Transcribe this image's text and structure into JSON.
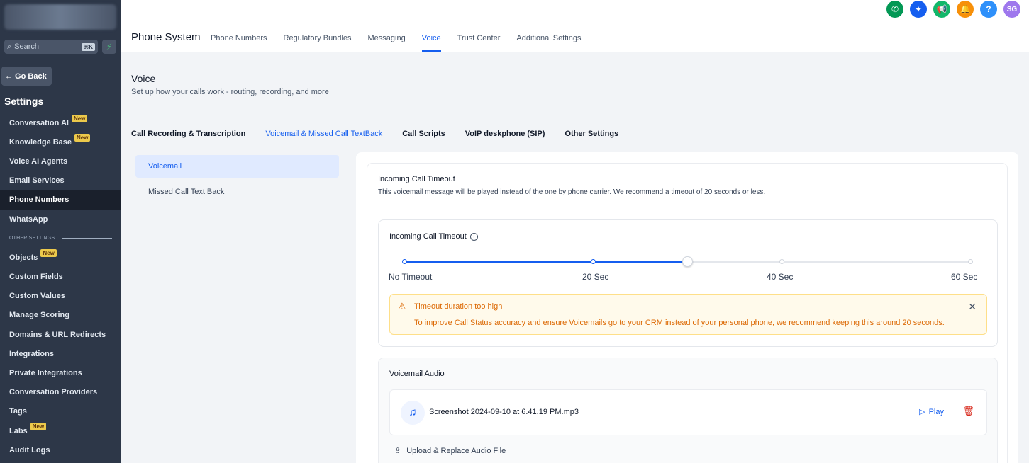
{
  "sidebar": {
    "search_placeholder": "Search",
    "search_shortcut": "⌘K",
    "go_back": "← Go Back",
    "title": "Settings",
    "items": [
      {
        "label": "Conversation AI",
        "badge": "New"
      },
      {
        "label": "Knowledge Base",
        "badge": "New"
      },
      {
        "label": "Voice AI Agents"
      },
      {
        "label": "Email Services"
      },
      {
        "label": "Phone Numbers",
        "active": true
      },
      {
        "label": "WhatsApp"
      },
      {
        "section": "OTHER SETTINGS"
      },
      {
        "label": "Objects",
        "badge": "New"
      },
      {
        "label": "Custom Fields"
      },
      {
        "label": "Custom Values"
      },
      {
        "label": "Manage Scoring"
      },
      {
        "label": "Domains & URL Redirects"
      },
      {
        "label": "Integrations"
      },
      {
        "label": "Private Integrations"
      },
      {
        "label": "Conversation Providers"
      },
      {
        "label": "Tags"
      },
      {
        "label": "Labs",
        "badge": "New"
      },
      {
        "label": "Audit Logs"
      }
    ]
  },
  "topbar": {
    "avatar_initials": "SG",
    "icons": [
      {
        "name": "phone-icon",
        "color": "#039855",
        "glyph": "✆"
      },
      {
        "name": "rocket-icon",
        "color": "#155eef",
        "glyph": "✦"
      },
      {
        "name": "megaphone-icon",
        "color": "#12b76a",
        "glyph": "📢"
      },
      {
        "name": "bell-icon",
        "color": "#f79009",
        "glyph": "🔔"
      },
      {
        "name": "help-icon",
        "color": "#2e90fa",
        "glyph": "?"
      }
    ]
  },
  "header": {
    "title": "Phone System",
    "tabs": [
      "Phone Numbers",
      "Regulatory Bundles",
      "Messaging",
      "Voice",
      "Trust Center",
      "Additional Settings"
    ],
    "active_tab": "Voice"
  },
  "page": {
    "title": "Voice",
    "subtitle": "Set up how your calls work - routing, recording, and more",
    "subtabs": [
      "Call Recording & Transcription",
      "Voicemail & Missed Call TextBack",
      "Call Scripts",
      "VoIP deskphone (SIP)",
      "Other Settings"
    ],
    "active_subtab": "Voicemail & Missed Call TextBack",
    "left_menu": [
      "Voicemail",
      "Missed Call Text Back"
    ]
  },
  "timeout": {
    "heading": "Incoming Call Timeout",
    "description": "This voicemail message will be played instead of the one by phone carrier. We recommend a timeout of 20 seconds or less.",
    "slider_label": "Incoming Call Timeout",
    "slider_marks": [
      "No Timeout",
      "20 Sec",
      "40 Sec",
      "60 Sec"
    ],
    "slider_value_seconds": 30,
    "slider_max_seconds": 60,
    "warning_title": "Timeout duration too high",
    "warning_text": "To improve Call Status accuracy and ensure Voicemails go to your CRM instead of your personal phone, we recommend keeping this around 20 seconds."
  },
  "audio": {
    "heading": "Voicemail Audio",
    "file_name": "Screenshot 2024-09-10 at 6.41.19 PM.mp3",
    "play_label": "Play",
    "upload_label": "Upload & Replace Audio File"
  }
}
